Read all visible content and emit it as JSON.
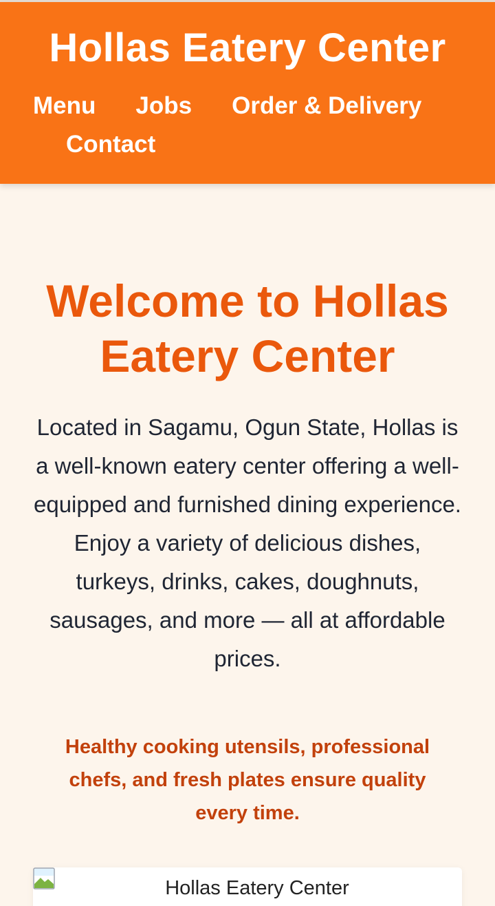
{
  "header": {
    "title": "Hollas Eatery Center",
    "nav": [
      {
        "label": "Menu"
      },
      {
        "label": "Jobs"
      },
      {
        "label": "Order & Delivery"
      },
      {
        "label": "Contact"
      }
    ]
  },
  "hero": {
    "heading": "Welcome to Hollas Eatery Center",
    "intro": "Located in Sagamu, Ogun State, Hollas is a well-known eatery center offering a well-equipped and furnished dining experience. Enjoy a variety of delicious dishes, turkeys, drinks, cakes, doughnuts, sausages, and more — all at affordable prices.",
    "highlight": "Healthy cooking utensils, professional chefs, and fresh plates ensure quality every time."
  },
  "image": {
    "alt": "Hollas Eatery Center",
    "icon": "broken-image-icon"
  },
  "colors": {
    "header_bg": "#f97316",
    "heading": "#ea580c",
    "highlight": "#c2410c",
    "page_bg": "#fdf5ec"
  }
}
